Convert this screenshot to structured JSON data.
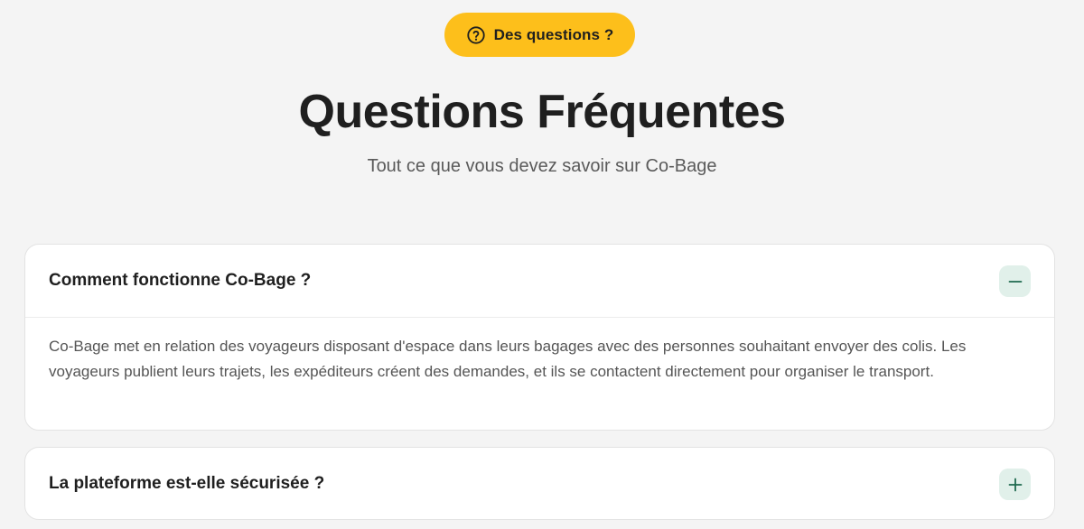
{
  "badge": {
    "icon": "question-circle-icon",
    "label": "Des questions ?",
    "color": "#fdbf1b"
  },
  "header": {
    "title": "Questions Fréquentes",
    "subtitle": "Tout ce que vous devez savoir sur Co-Bage"
  },
  "faq": {
    "items": [
      {
        "question": "Comment fonctionne Co-Bage ?",
        "expanded": true,
        "toggle_icon": "minus-icon",
        "answer": "Co-Bage met en relation des voyageurs disposant d'espace dans leurs bagages avec des personnes souhaitant envoyer des colis. Les voyageurs publient leurs trajets, les expéditeurs créent des demandes, et ils se contactent directement pour organiser le transport."
      },
      {
        "question": "La plateforme est-elle sécurisée ?",
        "expanded": false,
        "toggle_icon": "plus-icon"
      }
    ]
  },
  "colors": {
    "accent": "#fdbf1b",
    "toggle_bg": "#e1f0ea",
    "toggle_icon": "#1e6a4f",
    "page_bg": "#f4f4f4"
  }
}
